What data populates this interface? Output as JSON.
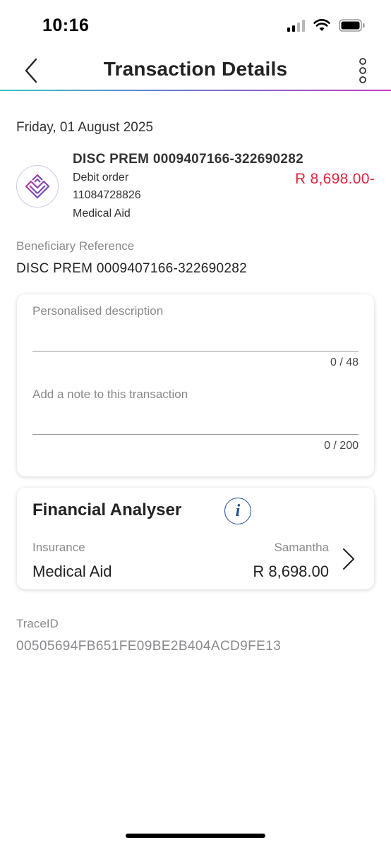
{
  "status_bar": {
    "time": "10:16"
  },
  "nav": {
    "title": "Transaction Details"
  },
  "transaction": {
    "date": "Friday, 01 August 2025",
    "name": "DISC PREM 0009407166-322690282",
    "type": "Debit order",
    "account": "11084728826",
    "category": "Medical Aid",
    "amount": "R 8,698.00-",
    "amount_color": "#e0233c"
  },
  "beneficiary": {
    "label": "Beneficiary Reference",
    "value": "DISC PREM 0009407166-322690282"
  },
  "notes": {
    "description_placeholder": "Personalised description",
    "description_counter": "0 / 48",
    "note_placeholder": "Add a note to this transaction",
    "note_counter": "0 / 200"
  },
  "financial_analyser": {
    "title": "Financial Analyser",
    "category_label": "Insurance",
    "category_value": "Medical Aid",
    "owner": "Samantha",
    "amount": "R 8,698.00"
  },
  "trace": {
    "label": "TraceID",
    "value": "00505694FB651FE09BE2B404ACD9FE13"
  },
  "icons": {
    "back": "chevron-left-icon",
    "more": "more-vertical-icon",
    "info": "info-icon",
    "chevron": "chevron-right-icon",
    "logo": "discovery-diamond-logo"
  },
  "colors": {
    "divider_gradient": [
      "#39c5c0",
      "#6b7bd8",
      "#c33ac0"
    ],
    "info_blue": "#1f4f96"
  }
}
